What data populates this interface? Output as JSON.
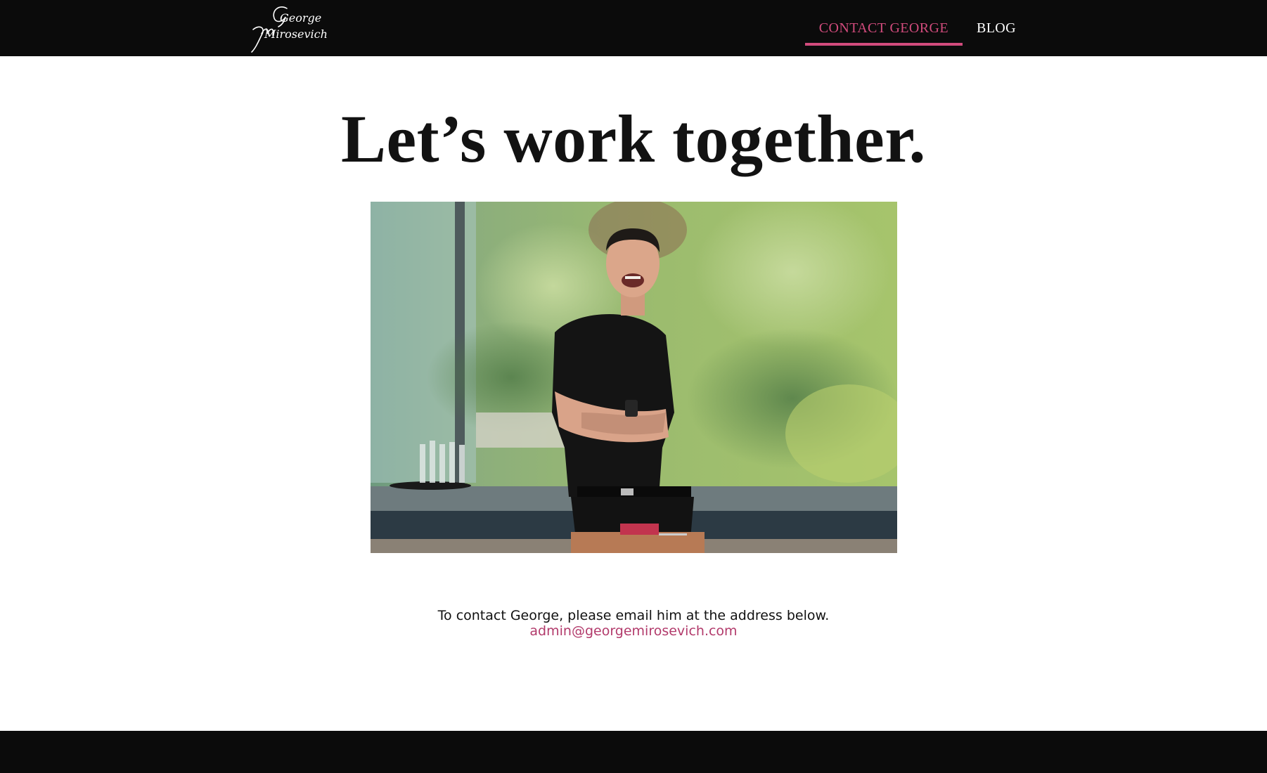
{
  "header": {
    "logo": {
      "line1": "George",
      "line2": "Mirosevich",
      "icon": "signature-logo"
    },
    "nav": [
      {
        "label": "CONTACT GEORGE",
        "active": true
      },
      {
        "label": "BLOG",
        "active": false
      }
    ]
  },
  "main": {
    "headline": "Let’s work together.",
    "photo": {
      "icon": "portrait-photo"
    },
    "contact_text": "To contact George, please email him at the address below.",
    "email": "admin@georgemirosevich.com"
  },
  "colors": {
    "background_dark": "#0b0b0b",
    "accent": "#d14b7c",
    "email_link": "#b23a6b"
  }
}
